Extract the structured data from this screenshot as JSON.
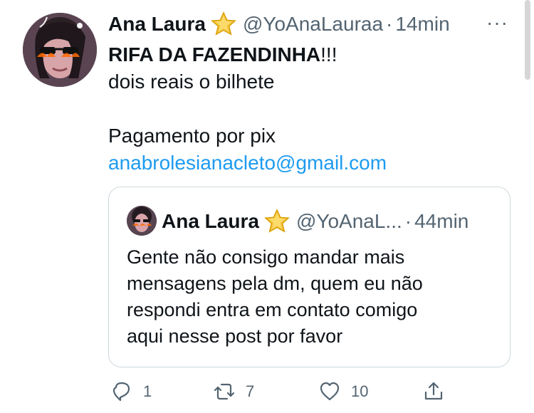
{
  "tweet": {
    "author_name": "Ana Laura",
    "handle": "@YoAnaLauraa",
    "separator": "·",
    "time": "14min",
    "more_label": "···",
    "text": {
      "line1_bold": "RIFA DA FAZENDINHA",
      "line1_suffix": "!!!",
      "line2": "dois reais o bilhete",
      "line4": "Pagamento por pix",
      "email": "anabrolesianacleto@gmail.com"
    }
  },
  "quote": {
    "author_name": "Ana Laura",
    "handle": "@YoAnaL...",
    "separator": "·",
    "time": "44min",
    "text": [
      "Gente não consigo mandar mais",
      "mensagens pela dm, quem eu não",
      "respondi entra em contato comigo",
      "aqui nesse post por favor"
    ]
  },
  "actions": {
    "reply_count": "1",
    "retweet_count": "7",
    "like_count": "10"
  },
  "icons": {
    "verified_emoji": "star-icon",
    "reply": "reply-icon",
    "retweet": "retweet-icon",
    "like": "heart-icon",
    "share": "share-icon"
  },
  "colors": {
    "text": "#0f1419",
    "secondary": "#536471",
    "link": "#1d9bf0",
    "border": "#cfd9de"
  }
}
